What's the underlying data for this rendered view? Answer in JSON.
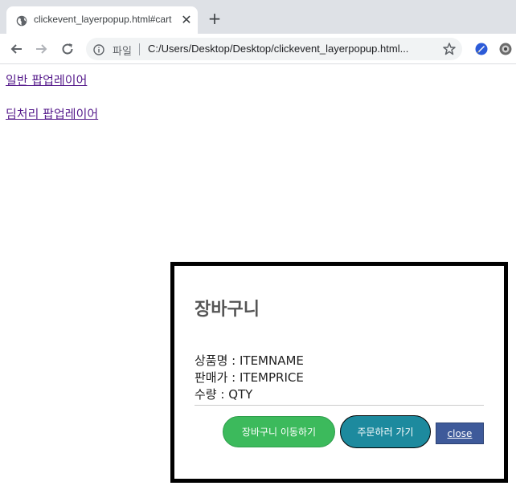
{
  "browser": {
    "tab_title": "clickevent_layerpopup.html#cart",
    "close_glyph": "✕",
    "new_tab_glyph": "+",
    "security_label": "파일",
    "url": "C:/Users/Desktop/Desktop/clickevent_layerpopup.html..."
  },
  "page": {
    "links": [
      "일반 팝업레이어",
      "딤처리 팝업레이어"
    ]
  },
  "popup": {
    "title": "장바구니",
    "product_name": "상품명 : ITEMNAME",
    "price": "판매가 : ITEMPRICE",
    "quantity": "수량 : QTY",
    "buttons": {
      "cart": "장바구니 이동하기",
      "order": "주문하러 가기",
      "close": "close"
    }
  },
  "colors": {
    "cart_button": "#3cba5c",
    "order_button": "#1d8a9e",
    "close_button": "#3e5a9a",
    "link_visited": "#551a8b"
  }
}
